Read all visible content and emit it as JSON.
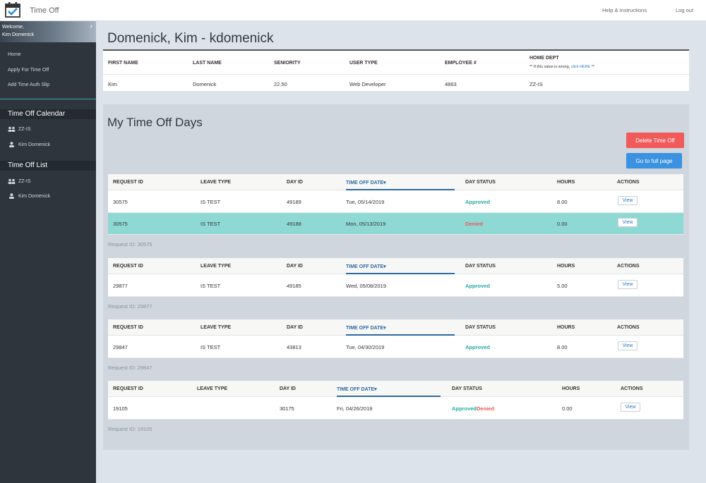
{
  "app": {
    "title": "Time Off"
  },
  "top_nav": {
    "help": "Help & Instructions",
    "logout": "Log out"
  },
  "sidebar": {
    "welcome": "Welcome,",
    "user": "Kim Domenick",
    "nav": [
      "Home",
      "Apply For Time Off",
      "Add Time Auth Slip"
    ],
    "calendar": {
      "title": "Time Off Calendar",
      "group": "ZZ-IS",
      "person": "Kim Domenick"
    },
    "list": {
      "title": "Time Off List",
      "group": "ZZ-IS",
      "person": "Kim Domenick"
    }
  },
  "employee": {
    "page_title": "Domenick, Kim - kdomenick",
    "headers": [
      "FIRST NAME",
      "LAST NAME",
      "SENIORITY",
      "USER TYPE",
      "EMPLOYEE #",
      "HOME DEPT"
    ],
    "note_prefix": "** If this value is wrong,",
    "note_link": "click HERE",
    "note_suffix": "**",
    "values": [
      "Kim",
      "Domenick",
      "22.50",
      "Web Developer",
      "4863",
      "ZZ-IS"
    ]
  },
  "time_off": {
    "title": "My Time Off Days",
    "delete_btn": "Delete Time Off",
    "full_page_btn": "Go to full page",
    "headers": [
      "REQUEST ID",
      "LEAVE TYPE",
      "DAY ID",
      "TIME OFF DATE",
      "DAY STATUS",
      "HOURS",
      "ACTIONS"
    ],
    "sort_arrow": "▾",
    "view_label": "View",
    "groups": [
      {
        "rows": [
          {
            "request_id": "30575",
            "leave_type": "IS TEST",
            "day_id": "49189",
            "date": "Tue, 05/14/2019",
            "status": "Approved",
            "status2": "",
            "hours": "8.00"
          },
          {
            "request_id": "30575",
            "leave_type": "IS TEST",
            "day_id": "49188",
            "date": "Mon, 05/13/2019",
            "status": "",
            "status2": "Denied",
            "hours": "0.00"
          }
        ],
        "note": "Request ID: 30575"
      },
      {
        "rows": [
          {
            "request_id": "29877",
            "leave_type": "IS TEST",
            "day_id": "49185",
            "date": "Wed, 05/08/2019",
            "status": "Approved",
            "status2": "",
            "hours": "5.00"
          }
        ],
        "note": "Request ID: 29877"
      },
      {
        "rows": [
          {
            "request_id": "29847",
            "leave_type": "IS TEST",
            "day_id": "43813",
            "date": "Tue, 04/30/2019",
            "status": "Approved",
            "status2": "",
            "hours": "8.00"
          }
        ],
        "note": "Request ID: 29847"
      },
      {
        "rows": [
          {
            "request_id": "19105",
            "leave_type": "",
            "day_id": "30175",
            "date": "Fri, 04/26/2019",
            "status": "Approved",
            "status2": "Denied",
            "hours": "0.00"
          }
        ],
        "note": "Request ID: 19105"
      }
    ]
  },
  "colors": {
    "approved": "#27a9a3",
    "denied": "#e65a5a",
    "highlight_row": "#8fd9d5",
    "sort_accent": "#2d6aa3"
  }
}
